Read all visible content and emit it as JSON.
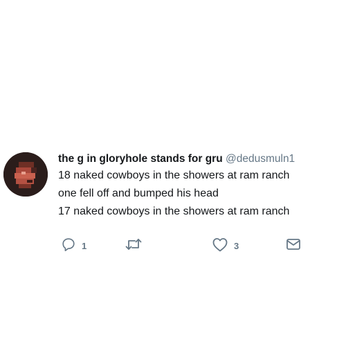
{
  "tweet": {
    "display_name": "the g in gloryhole stands for gru",
    "handle": "@dedusmuln1",
    "lines": [
      "18 naked cowboys in the showers at ram ranch",
      "one fell off and bumped his head",
      "17 naked cowboys in the showers at ram ranch"
    ],
    "actions": {
      "reply": {
        "icon": "reply-icon",
        "count": "1"
      },
      "retweet": {
        "icon": "retweet-icon",
        "count": ""
      },
      "like": {
        "icon": "heart-icon",
        "count": "3"
      },
      "dm": {
        "icon": "envelope-icon",
        "count": ""
      }
    }
  },
  "colors": {
    "text": "#14171a",
    "muted": "#657786",
    "background": "#ffffff"
  }
}
